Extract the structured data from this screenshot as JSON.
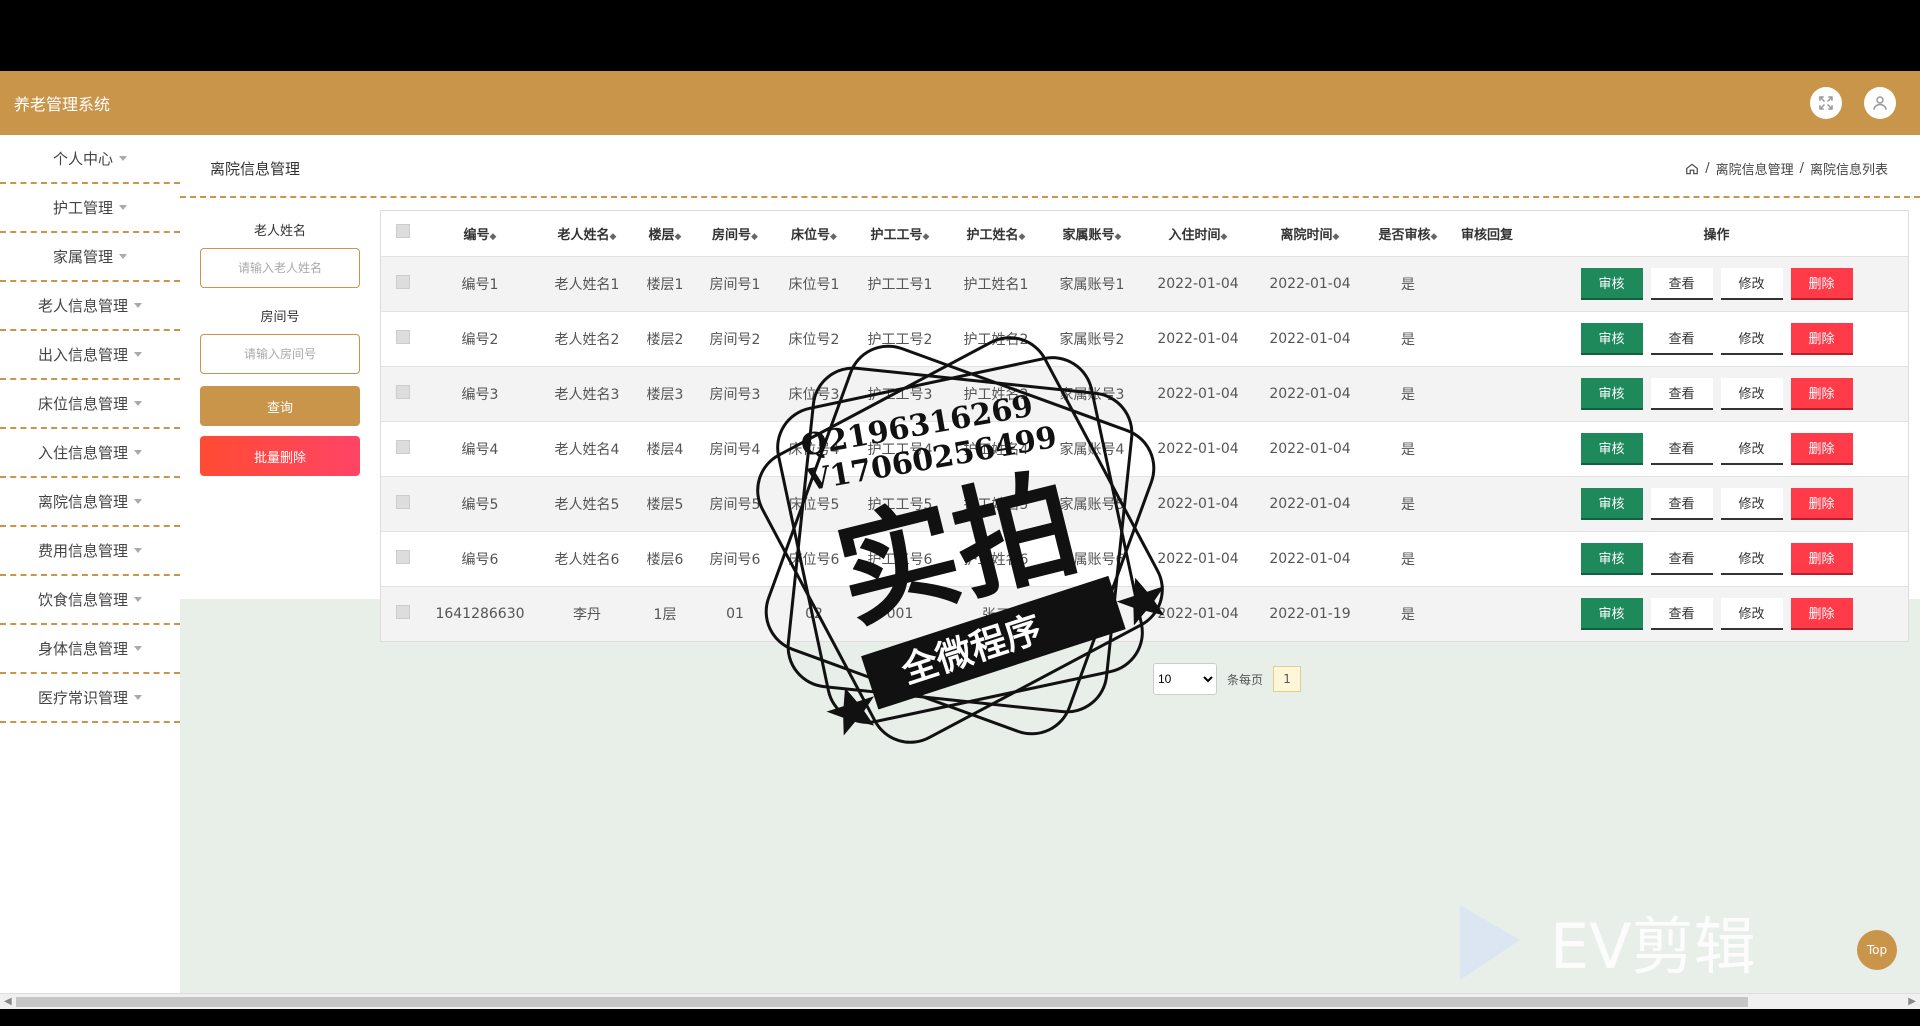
{
  "app": {
    "title": "养老管理系统"
  },
  "header": {
    "fullscreen_icon": "fullscreen-icon",
    "user_icon": "user-icon"
  },
  "sidebar": {
    "items": [
      {
        "label": "个人中心"
      },
      {
        "label": "护工管理"
      },
      {
        "label": "家属管理"
      },
      {
        "label": "老人信息管理"
      },
      {
        "label": "出入信息管理"
      },
      {
        "label": "床位信息管理"
      },
      {
        "label": "入住信息管理"
      },
      {
        "label": "离院信息管理"
      },
      {
        "label": "费用信息管理"
      },
      {
        "label": "饮食信息管理"
      },
      {
        "label": "身体信息管理"
      },
      {
        "label": "医疗常识管理"
      }
    ]
  },
  "page": {
    "title": "离院信息管理"
  },
  "breadcrumb": {
    "home_icon": "home-icon",
    "level1": "离院信息管理",
    "sep": "/",
    "level2": "离院信息列表"
  },
  "filter": {
    "name_label": "老人姓名",
    "name_placeholder": "请输入老人姓名",
    "room_label": "房间号",
    "room_placeholder": "请输入房间号",
    "search_label": "查询",
    "batch_delete_label": "批量删除"
  },
  "table": {
    "columns": [
      "编号",
      "老人姓名",
      "楼层",
      "房间号",
      "床位号",
      "护工工号",
      "护工姓名",
      "家属账号",
      "入住时间",
      "离院时间",
      "是否审核",
      "审核回复",
      "操作"
    ],
    "sort_mark": "◆",
    "rows": [
      [
        "编号1",
        "老人姓名1",
        "楼层1",
        "房间号1",
        "床位号1",
        "护工工号1",
        "护工姓名1",
        "家属账号1",
        "2022-01-04",
        "2022-01-04",
        "是",
        ""
      ],
      [
        "编号2",
        "老人姓名2",
        "楼层2",
        "房间号2",
        "床位号2",
        "护工工号2",
        "护工姓名2",
        "家属账号2",
        "2022-01-04",
        "2022-01-04",
        "是",
        ""
      ],
      [
        "编号3",
        "老人姓名3",
        "楼层3",
        "房间号3",
        "床位号3",
        "护工工号3",
        "护工姓名3",
        "家属账号3",
        "2022-01-04",
        "2022-01-04",
        "是",
        ""
      ],
      [
        "编号4",
        "老人姓名4",
        "楼层4",
        "房间号4",
        "床位号4",
        "护工工号4",
        "护工姓名4",
        "家属账号4",
        "2022-01-04",
        "2022-01-04",
        "是",
        ""
      ],
      [
        "编号5",
        "老人姓名5",
        "楼层5",
        "房间号5",
        "床位号5",
        "护工工号5",
        "护工姓名5",
        "家属账号5",
        "2022-01-04",
        "2022-01-04",
        "是",
        ""
      ],
      [
        "编号6",
        "老人姓名6",
        "楼层6",
        "房间号6",
        "床位号6",
        "护工工号6",
        "护工姓名6",
        "家属账号6",
        "2022-01-04",
        "2022-01-04",
        "是",
        ""
      ],
      [
        "1641286630",
        "李丹",
        "1层",
        "01",
        "02",
        "001",
        "张三",
        "1",
        "2022-01-04",
        "2022-01-19",
        "是",
        ""
      ]
    ],
    "actions": {
      "audit": "审核",
      "view": "查看",
      "edit": "修改",
      "delete": "删除"
    }
  },
  "pagination": {
    "page_size": "10",
    "per_page_label": "条每页",
    "current_page": "1"
  },
  "top_button": {
    "label": "Top"
  },
  "watermark": {
    "qq": "Q2196316269",
    "v": "V17060256499",
    "big_text": "实拍",
    "ribbon_text": "全微程序",
    "ev_text": "EV剪辑"
  },
  "colors": {
    "brand": "#c9954a",
    "audit": "#1e8a5c",
    "delete": "#ff3b4a",
    "batch_delete": "#ff4466"
  }
}
